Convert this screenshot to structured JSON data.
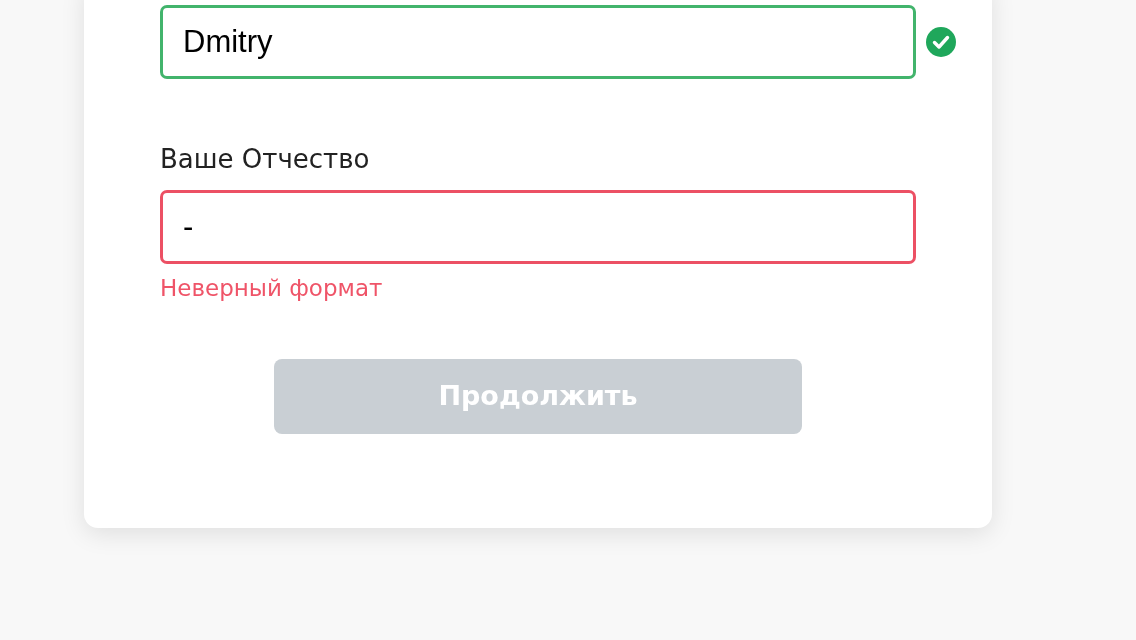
{
  "fields": [
    {
      "value": "Dmitry",
      "valid": true
    },
    {
      "label": "Ваше Отчество",
      "value": "-",
      "valid": false,
      "error": "Неверный формат"
    }
  ],
  "continue_button": {
    "label": "Продолжить",
    "disabled": true
  }
}
